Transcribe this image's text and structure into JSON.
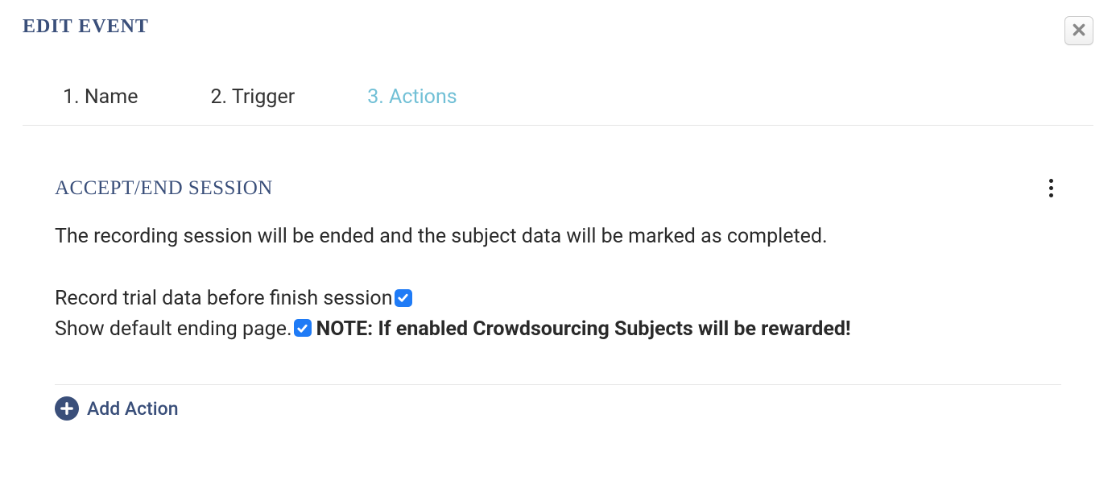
{
  "dialog": {
    "title": "EDIT EVENT"
  },
  "tabs": [
    {
      "label": "1. Name",
      "active": false
    },
    {
      "label": "2. Trigger",
      "active": false
    },
    {
      "label": "3. Actions",
      "active": true
    }
  ],
  "section": {
    "title": "ACCEPT/END SESSION",
    "description": "The recording session will be ended and the subject data will be marked as completed.",
    "options": {
      "record_label": "Record trial data before finish session",
      "record_checked": true,
      "show_label": "Show default ending page.",
      "show_checked": true,
      "note": " NOTE: If enabled Crowdsourcing Subjects will be rewarded!"
    }
  },
  "footer": {
    "add_action": "Add Action"
  }
}
